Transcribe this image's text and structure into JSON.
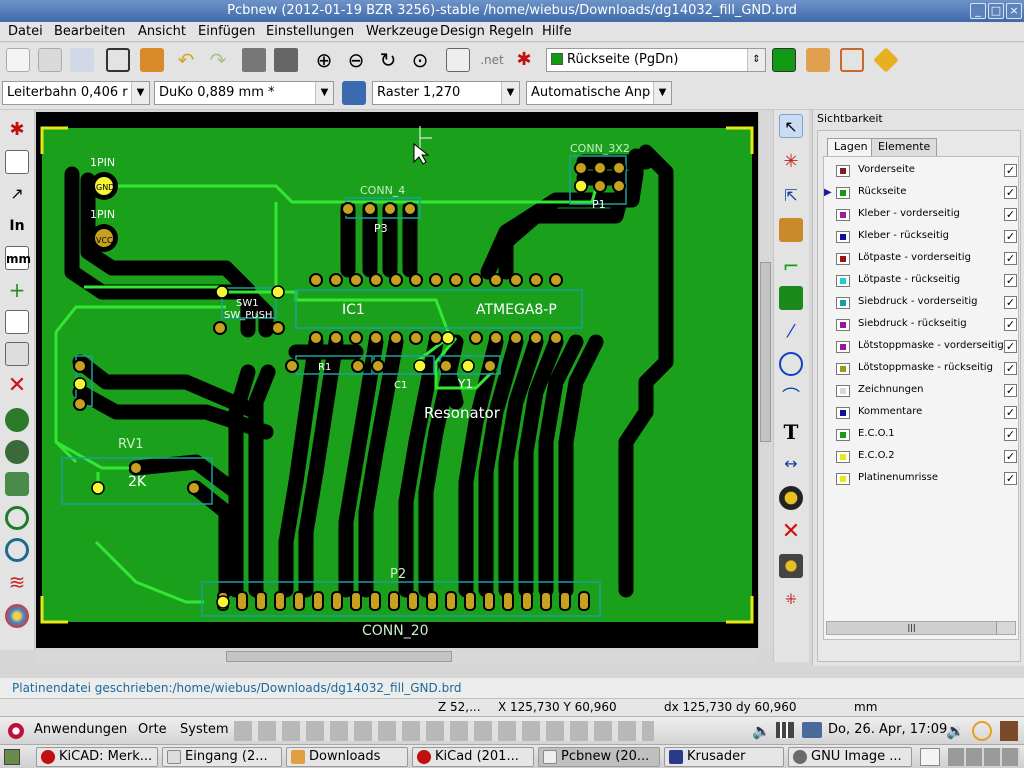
{
  "window": {
    "title": "Pcbnew (2012-01-19 BZR 3256)-stable /home/wiebus/Downloads/dg14032_fill_GND.brd",
    "min": "_",
    "max": "□",
    "close": "×"
  },
  "menu": [
    "Datei",
    "Bearbeiten",
    "Ansicht",
    "Einfügen",
    "Einstellungen",
    "Werkzeuge",
    "Design Regeln",
    "Hilfe"
  ],
  "toolbar2": {
    "layer_select": "Rückseite (PgDn)"
  },
  "toolbar3": {
    "track": "Leiterbahn 0,406 r",
    "via": "DuKo 0,889 mm *",
    "grid": "Raster 1,270",
    "zoom": "Automatische Anp"
  },
  "pcb_labels": {
    "p1pin_top": "1PIN",
    "p1pin_bot": "1PIN",
    "gnd": "GND",
    "vcc": "VCC",
    "conn4": "CONN_4",
    "p3": "P3",
    "conn3x2": "CONN_3X2",
    "p1": "P1",
    "sw1": "SW1",
    "swpush": "SW_PUSH",
    "ic1": "IC1",
    "atmega": "ATMEGA8-P",
    "r1": "R1",
    "c1": "C1",
    "y1": "Y1",
    "resonator": "Resonator",
    "rv1": "RV1",
    "twok": "2K",
    "p2": "P2",
    "conn20": "CONN_20"
  },
  "panel": {
    "title": "Sichtbarkeit",
    "tabs": [
      "Lagen",
      "Elemente"
    ],
    "layers": [
      {
        "name": "Vorderseite",
        "color": "#8b1a1a"
      },
      {
        "name": "Rückseite",
        "color": "#139a13"
      },
      {
        "name": "Kleber - vorderseitig",
        "color": "#9b1b9b"
      },
      {
        "name": "Kleber - rückseitig",
        "color": "#10109a"
      },
      {
        "name": "Lötpaste - vorderseitig",
        "color": "#9b1414"
      },
      {
        "name": "Lötpaste - rückseitig",
        "color": "#14d2d2"
      },
      {
        "name": "Siebdruck - vorderseitig",
        "color": "#14a0a0"
      },
      {
        "name": "Siebdruck - rückseitig",
        "color": "#9b149b"
      },
      {
        "name": "Lötstoppmaske - vorderseitig",
        "color": "#9b149b"
      },
      {
        "name": "Lötstoppmaske - rückseitig",
        "color": "#9b9b14"
      },
      {
        "name": "Zeichnungen",
        "color": "#d8d8d8"
      },
      {
        "name": "Kommentare",
        "color": "#10109a"
      },
      {
        "name": "E.C.O.1",
        "color": "#14a014"
      },
      {
        "name": "E.C.O.2",
        "color": "#e8e814"
      },
      {
        "name": "Platinenumrisse",
        "color": "#e8e814"
      }
    ],
    "check": "✓",
    "scroll_grip": "|||"
  },
  "message": "Platinendatei geschrieben:/home/wiebus/Downloads/dg14032_fill_GND.brd",
  "status": {
    "zoom": "Z 52,...",
    "xy": "X 125,730  Y 60,960",
    "dxdy": "dx 125,730  dy 60,960",
    "unit": "mm"
  },
  "gnome": {
    "apps": "Anwendungen",
    "places": "Orte",
    "system": "System",
    "clock": "Do, 26. Apr, 17:09"
  },
  "tasks": [
    "KiCAD: Merk...",
    "Eingang (2...",
    "Downloads",
    "KiCad (201...",
    "Pcbnew (20...",
    "Krusader",
    "GNU Image ..."
  ]
}
